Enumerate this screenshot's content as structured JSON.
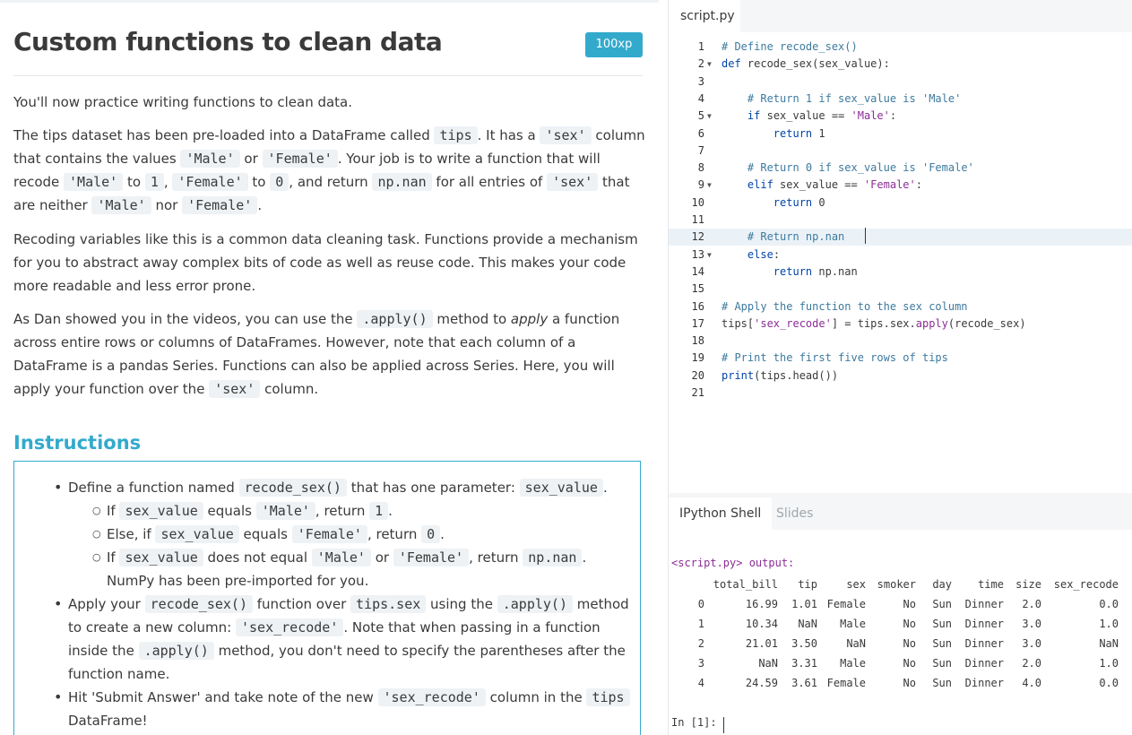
{
  "exercise": {
    "title": "Custom functions to clean data",
    "xp": "100xp",
    "intro": "You'll now practice writing functions to clean data.",
    "p2": {
      "t1": "The tips dataset has been pre-loaded into a DataFrame called ",
      "c1": "tips",
      "t2": ". It has a ",
      "c2": "'sex'",
      "t3": " column that contains the values ",
      "c3": "'Male'",
      "t4": " or ",
      "c4": "'Female'",
      "t5": ". Your job is to write a function that will recode ",
      "c5": "'Male'",
      "t6": " to ",
      "c6": "1",
      "t7": ", ",
      "c7": "'Female'",
      "t8": " to ",
      "c8": "0",
      "t9": ", and return ",
      "c9": "np.nan",
      "t10": " for all entries of ",
      "c10": "'sex'",
      "t11": " that are neither ",
      "c11": "'Male'",
      "t12": " nor ",
      "c12": "'Female'",
      "t13": "."
    },
    "p3": "Recoding variables like this is a common data cleaning task. Functions provide a mechanism for you to abstract away complex bits of code as well as reuse code. This makes your code more readable and less error prone.",
    "p4": {
      "t1": "As Dan showed you in the videos, you can use the ",
      "c1": ".apply()",
      "t2": " method to ",
      "em": "apply",
      "t3": " a function across entire rows or columns of DataFrames. However, note that each column of a DataFrame is a pandas Series. Functions can also be applied across Series. Here, you will apply your function over the ",
      "c2": "'sex'",
      "t4": " column."
    }
  },
  "instructions": {
    "title": "Instructions",
    "b1": {
      "t1": "Define a function named ",
      "c1": "recode_sex()",
      "t2": " that has one parameter: ",
      "c2": "sex_value",
      "t3": "."
    },
    "s1": {
      "t1": "If ",
      "c1": "sex_value",
      "t2": " equals ",
      "c2": "'Male'",
      "t3": ", return ",
      "c3": "1",
      "t4": "."
    },
    "s2": {
      "t1": "Else, if ",
      "c1": "sex_value",
      "t2": " equals ",
      "c2": "'Female'",
      "t3": ", return ",
      "c3": "0",
      "t4": "."
    },
    "s3": {
      "t1": "If ",
      "c1": "sex_value",
      "t2": " does not equal ",
      "c2": "'Male'",
      "t3": " or ",
      "c3": "'Female'",
      "t4": ", return ",
      "c4": "np.nan",
      "t5": ". NumPy has been pre-imported for you."
    },
    "b2": {
      "t1": "Apply your ",
      "c1": "recode_sex()",
      "t2": " function over ",
      "c2": "tips.sex",
      "t3": " using the ",
      "c3": ".apply()",
      "t4": " method to create a new column: ",
      "c4": "'sex_recode'",
      "t5": ". Note that when passing in a function inside the ",
      "c5": ".apply()",
      "t6": " method, you don't need to specify the parentheses after the function name."
    },
    "b3": {
      "t1": "Hit 'Submit Answer' and take note of the new ",
      "c1": "'sex_recode'",
      "t2": " column in the ",
      "c2": "tips",
      "t3": " DataFrame!"
    }
  },
  "editor": {
    "tab": "script.py",
    "lines": [
      {
        "n": "1",
        "fold": "",
        "parts": [
          [
            "cm",
            "# Define recode_sex()"
          ]
        ]
      },
      {
        "n": "2",
        "fold": "▼",
        "parts": [
          [
            "k",
            "def "
          ],
          [
            "",
            "recode_sex(sex_value):"
          ]
        ]
      },
      {
        "n": "3",
        "fold": "",
        "parts": []
      },
      {
        "n": "4",
        "fold": "",
        "parts": [
          [
            "",
            "    "
          ],
          [
            "cm",
            "# Return 1 if sex_value is 'Male'"
          ]
        ]
      },
      {
        "n": "5",
        "fold": "▼",
        "parts": [
          [
            "",
            "    "
          ],
          [
            "k",
            "if "
          ],
          [
            "",
            "sex_value == "
          ],
          [
            "s",
            "'Male'"
          ],
          [
            "",
            ":"
          ]
        ]
      },
      {
        "n": "6",
        "fold": "",
        "parts": [
          [
            "",
            "        "
          ],
          [
            "k",
            "return "
          ],
          [
            "",
            "1"
          ]
        ]
      },
      {
        "n": "7",
        "fold": "",
        "parts": []
      },
      {
        "n": "8",
        "fold": "",
        "parts": [
          [
            "",
            "    "
          ],
          [
            "cm",
            "# Return 0 if sex_value is 'Female'"
          ]
        ]
      },
      {
        "n": "9",
        "fold": "▼",
        "parts": [
          [
            "",
            "    "
          ],
          [
            "k",
            "elif "
          ],
          [
            "",
            "sex_value == "
          ],
          [
            "s",
            "'Female'"
          ],
          [
            "",
            ":"
          ]
        ]
      },
      {
        "n": "10",
        "fold": "",
        "parts": [
          [
            "",
            "        "
          ],
          [
            "k",
            "return "
          ],
          [
            "",
            "0"
          ]
        ]
      },
      {
        "n": "11",
        "fold": "",
        "parts": []
      },
      {
        "n": "12",
        "fold": "",
        "parts": [
          [
            "",
            "    "
          ],
          [
            "cm",
            "# Return np.nan"
          ]
        ]
      },
      {
        "n": "13",
        "fold": "▼",
        "parts": [
          [
            "",
            "    "
          ],
          [
            "k",
            "else"
          ],
          [
            "",
            ":"
          ]
        ]
      },
      {
        "n": "14",
        "fold": "",
        "parts": [
          [
            "",
            "        "
          ],
          [
            "k",
            "return "
          ],
          [
            "",
            "np.nan"
          ]
        ]
      },
      {
        "n": "15",
        "fold": "",
        "parts": []
      },
      {
        "n": "16",
        "fold": "",
        "parts": [
          [
            "cm",
            "# Apply the function to the sex column"
          ]
        ]
      },
      {
        "n": "17",
        "fold": "",
        "parts": [
          [
            "",
            "tips["
          ],
          [
            "s",
            "'sex_recode'"
          ],
          [
            "",
            "] = tips.sex."
          ],
          [
            "fn",
            "apply"
          ],
          [
            "",
            "(recode_sex)"
          ]
        ]
      },
      {
        "n": "18",
        "fold": "",
        "parts": []
      },
      {
        "n": "19",
        "fold": "",
        "parts": [
          [
            "cm",
            "# Print the first five rows of tips"
          ]
        ]
      },
      {
        "n": "20",
        "fold": "",
        "parts": [
          [
            "k",
            "print"
          ],
          [
            "",
            "(tips.head())"
          ]
        ]
      },
      {
        "n": "21",
        "fold": "",
        "parts": []
      }
    ]
  },
  "shell": {
    "tabs": [
      "IPython Shell",
      "Slides"
    ],
    "output_label": "<script.py> output:",
    "columns": [
      "",
      "total_bill",
      "tip",
      "sex",
      "smoker",
      "day",
      "time",
      "size",
      "sex_recode"
    ],
    "rows": [
      [
        "0",
        "16.99",
        "1.01",
        "Female",
        "No",
        "Sun",
        "Dinner",
        "2.0",
        "0.0"
      ],
      [
        "1",
        "10.34",
        "NaN",
        "Male",
        "No",
        "Sun",
        "Dinner",
        "3.0",
        "1.0"
      ],
      [
        "2",
        "21.01",
        "3.50",
        "NaN",
        "No",
        "Sun",
        "Dinner",
        "3.0",
        "NaN"
      ],
      [
        "3",
        "NaN",
        "3.31",
        "Male",
        "No",
        "Sun",
        "Dinner",
        "2.0",
        "1.0"
      ],
      [
        "4",
        "24.59",
        "3.61",
        "Female",
        "No",
        "Sun",
        "Dinner",
        "4.0",
        "0.0"
      ]
    ],
    "prompt": "In [1]:"
  }
}
